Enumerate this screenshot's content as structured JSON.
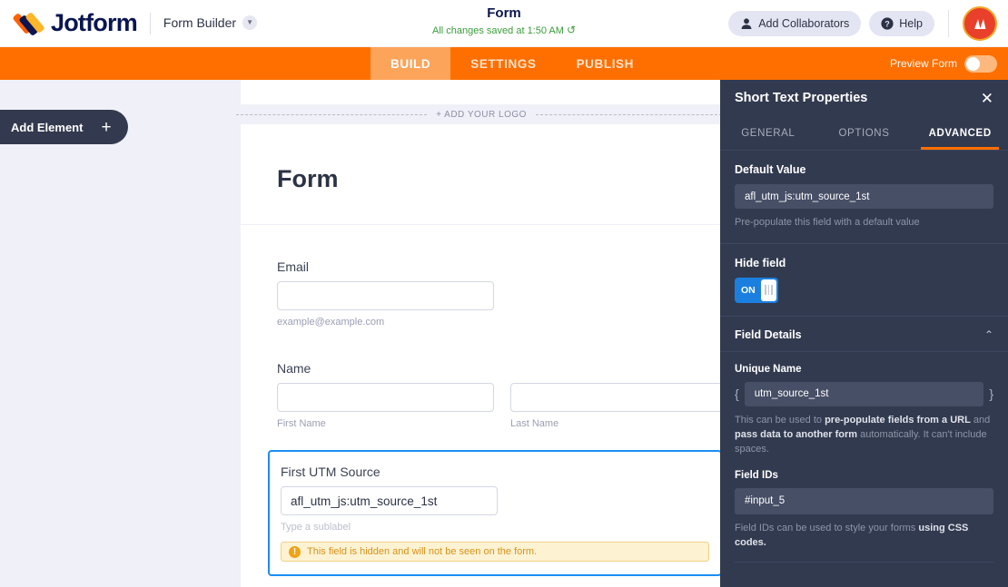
{
  "header": {
    "brand_name": "Jotform",
    "builder_label": "Form Builder",
    "form_title": "Form",
    "save_status": "All changes saved at 1:50 AM",
    "undo_icon": "↺",
    "add_collaborators_label": "Add Collaborators",
    "help_label": "Help",
    "person_icon": "person-icon",
    "help_icon": "question-circle-icon",
    "avatar_icon": "user-avatar"
  },
  "nav": {
    "tabs": [
      {
        "label": "BUILD",
        "active": true
      },
      {
        "label": "SETTINGS",
        "active": false
      },
      {
        "label": "PUBLISH",
        "active": false
      }
    ],
    "preview_label": "Preview Form"
  },
  "canvas": {
    "add_element_label": "Add Element",
    "plus_icon": "+",
    "add_logo_label": "+ ADD YOUR LOGO",
    "form_heading": "Form",
    "fields": {
      "email": {
        "label": "Email",
        "value": "",
        "sublabel": "example@example.com"
      },
      "name": {
        "label": "Name",
        "first_value": "",
        "first_sublabel": "First Name",
        "last_value": "",
        "last_sublabel": "Last Name"
      },
      "utm": {
        "label": "First UTM Source",
        "value": "afl_utm_js:utm_source_1st",
        "sublabel_placeholder": "Type a sublabel",
        "warning_icon": "!",
        "warning_text": "This field is hidden and will not be seen on the form."
      }
    }
  },
  "panel": {
    "title": "Short Text Properties",
    "close_icon": "✕",
    "tabs": [
      {
        "label": "GENERAL",
        "active": false
      },
      {
        "label": "OPTIONS",
        "active": false
      },
      {
        "label": "ADVANCED",
        "active": true
      }
    ],
    "default_value": {
      "label": "Default Value",
      "value": "afl_utm_js:utm_source_1st",
      "help": "Pre-populate this field with a default value"
    },
    "hide_field": {
      "label": "Hide field",
      "toggle_state": "ON"
    },
    "field_details": {
      "label": "Field Details",
      "collapse_icon": "⌃",
      "unique_name": {
        "label": "Unique Name",
        "brace_open": "{",
        "brace_close": "}",
        "value": "utm_source_1st",
        "help_part1": "This can be used to ",
        "help_bold1": "pre-populate fields from a URL",
        "help_part2": " and ",
        "help_bold2": "pass data to another form",
        "help_part3": " automatically. It can't include spaces."
      },
      "field_ids": {
        "label": "Field IDs",
        "value": "#input_5",
        "help_part1": "Field IDs can be used to style your forms ",
        "help_bold1": "using CSS codes."
      }
    }
  },
  "colors": {
    "brand_orange": "#ff6f00",
    "panel_dark": "#323a4f",
    "accent_blue": "#1b8ef2",
    "save_green": "#3a9c3a",
    "warning_yellow": "#fdf3d3"
  }
}
